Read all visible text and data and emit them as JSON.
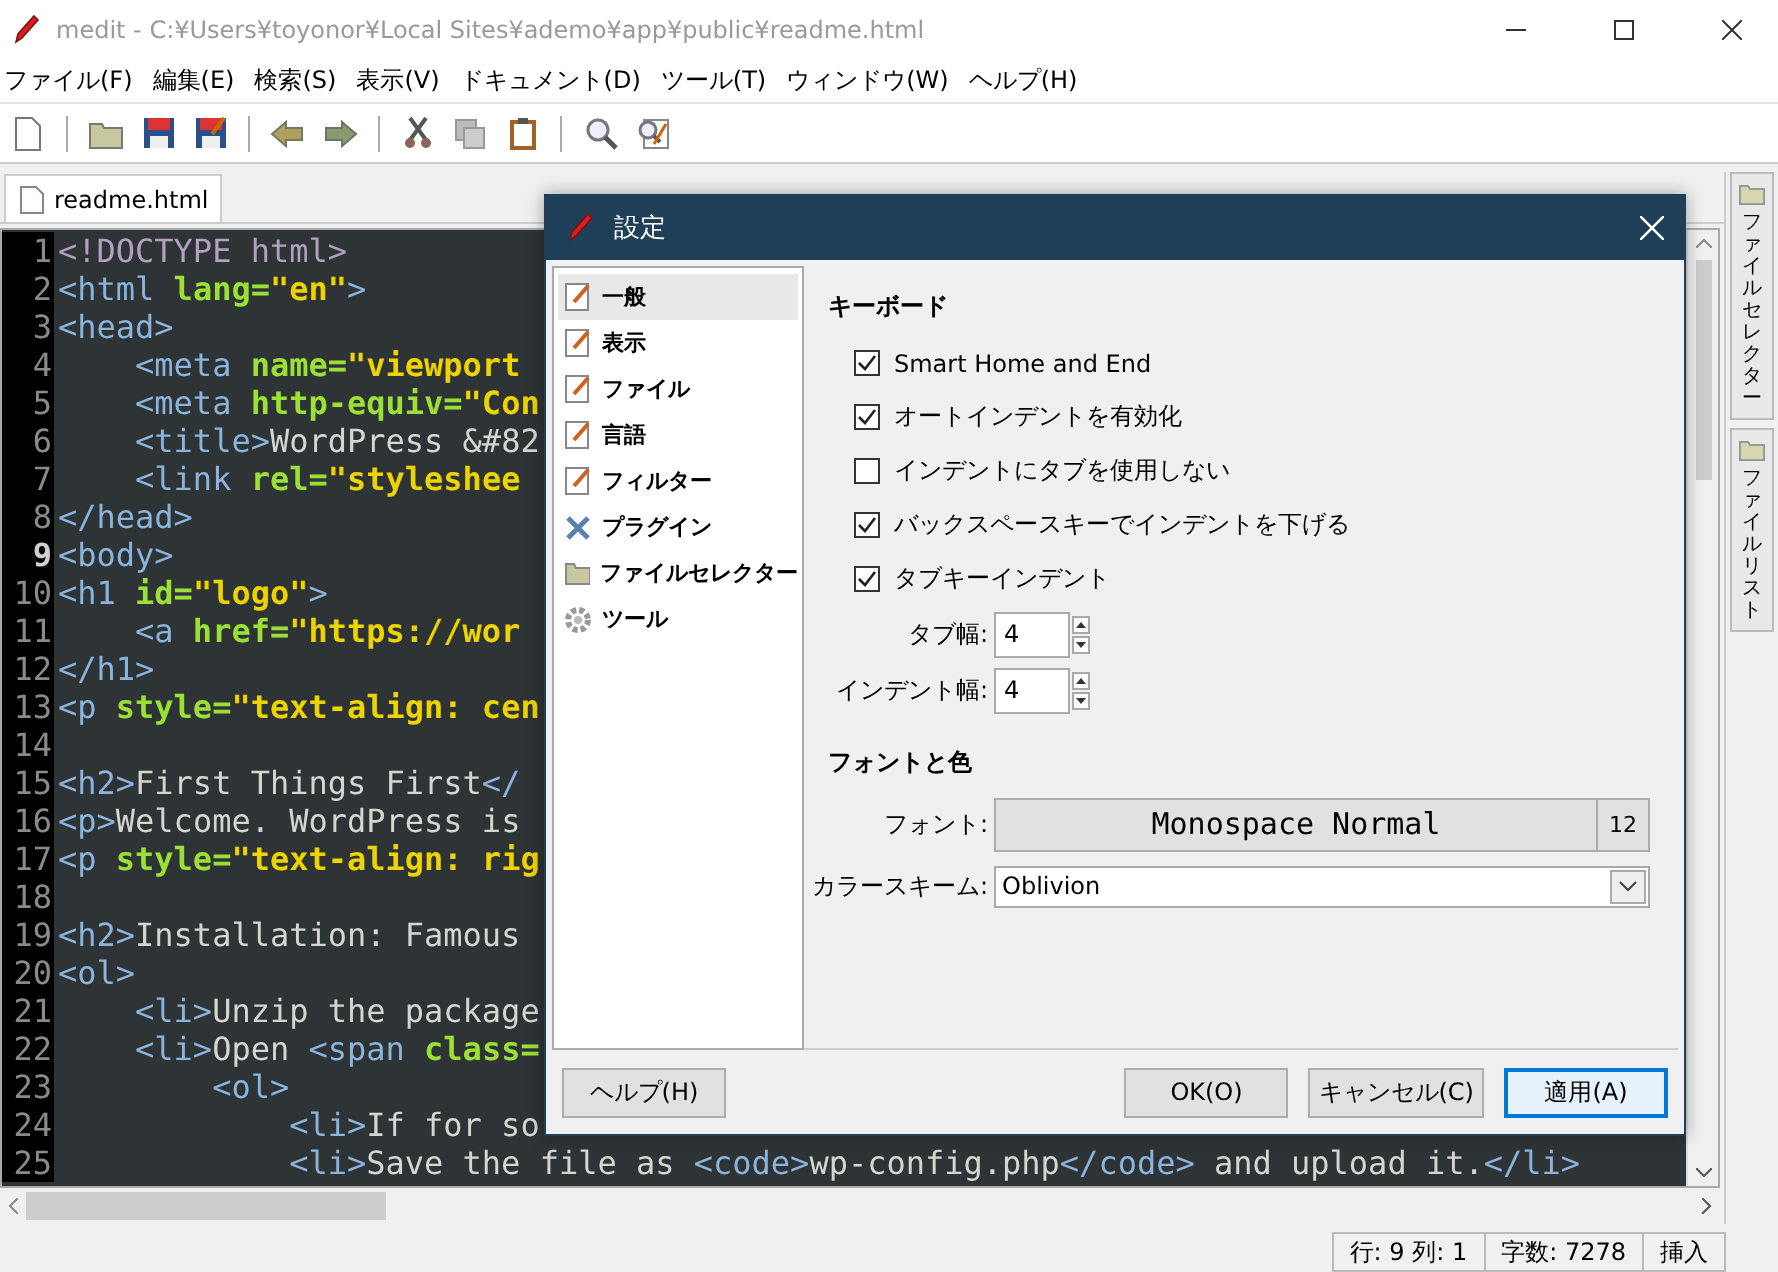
{
  "window": {
    "title": "medit - C:¥Users¥toyonor¥Local Sites¥ademo¥app¥public¥readme.html"
  },
  "menu": [
    "ファイル(F)",
    "編集(E)",
    "検索(S)",
    "表示(V)",
    "ドキュメント(D)",
    "ツール(T)",
    "ウィンドウ(W)",
    "ヘルプ(H)"
  ],
  "tabs": [
    {
      "label": "readme.html",
      "selected": true
    }
  ],
  "editor": {
    "lines": [
      {
        "number": "1",
        "current": false,
        "tokens": [
          {
            "kind": "doctype",
            "text": "<!DOCTYPE html>"
          }
        ]
      },
      {
        "number": "2",
        "current": false,
        "tokens": [
          {
            "kind": "tag",
            "text": "<html"
          },
          {
            "kind": "attr",
            "text": " lang="
          },
          {
            "kind": "string",
            "text": "\"en\""
          },
          {
            "kind": "tag",
            "text": ">"
          }
        ]
      },
      {
        "number": "3",
        "current": false,
        "tokens": [
          {
            "kind": "tag",
            "text": "<head>"
          }
        ]
      },
      {
        "number": "4",
        "current": false,
        "tokens": [
          {
            "kind": "tag",
            "text": "    <meta"
          },
          {
            "kind": "attr",
            "text": " name="
          },
          {
            "kind": "string",
            "text": "\"viewport"
          }
        ]
      },
      {
        "number": "5",
        "current": false,
        "tokens": [
          {
            "kind": "tag",
            "text": "    <meta"
          },
          {
            "kind": "attr",
            "text": " http-equiv="
          },
          {
            "kind": "string",
            "text": "\"Con"
          }
        ]
      },
      {
        "number": "6",
        "current": false,
        "tokens": [
          {
            "kind": "tag",
            "text": "    <title>"
          },
          {
            "kind": "text",
            "text": "WordPress &#82"
          }
        ]
      },
      {
        "number": "7",
        "current": false,
        "tokens": [
          {
            "kind": "tag",
            "text": "    <link"
          },
          {
            "kind": "attr",
            "text": " rel="
          },
          {
            "kind": "string",
            "text": "\"styleshee"
          }
        ]
      },
      {
        "number": "8",
        "current": false,
        "tokens": [
          {
            "kind": "tag",
            "text": "</head>"
          }
        ]
      },
      {
        "number": "9",
        "current": true,
        "tokens": [
          {
            "kind": "tag",
            "text": "<body>"
          }
        ]
      },
      {
        "number": "10",
        "current": false,
        "tokens": [
          {
            "kind": "tag",
            "text": "<h1"
          },
          {
            "kind": "attr",
            "text": " id="
          },
          {
            "kind": "string",
            "text": "\"logo\""
          },
          {
            "kind": "tag",
            "text": ">"
          }
        ]
      },
      {
        "number": "11",
        "current": false,
        "tokens": [
          {
            "kind": "tag",
            "text": "    <a"
          },
          {
            "kind": "attr",
            "text": " href="
          },
          {
            "kind": "string",
            "text": "\"https://wor"
          }
        ]
      },
      {
        "number": "12",
        "current": false,
        "tokens": [
          {
            "kind": "tag",
            "text": "</h1>"
          }
        ]
      },
      {
        "number": "13",
        "current": false,
        "tokens": [
          {
            "kind": "tag",
            "text": "<p"
          },
          {
            "kind": "attr",
            "text": " style="
          },
          {
            "kind": "string",
            "text": "\"text-align: cen"
          }
        ]
      },
      {
        "number": "14",
        "current": false
      },
      {
        "number": "15",
        "current": false,
        "tokens": [
          {
            "kind": "tag",
            "text": "<h2>"
          },
          {
            "kind": "text",
            "text": "First Things First"
          },
          {
            "kind": "tag",
            "text": "</"
          }
        ]
      },
      {
        "number": "16",
        "current": false,
        "tokens": [
          {
            "kind": "tag",
            "text": "<p>"
          },
          {
            "kind": "text",
            "text": "Welcome. WordPress is"
          }
        ]
      },
      {
        "number": "17",
        "current": false,
        "tokens": [
          {
            "kind": "tag",
            "text": "<p"
          },
          {
            "kind": "attr",
            "text": " style="
          },
          {
            "kind": "string",
            "text": "\"text-align: rig"
          }
        ]
      },
      {
        "number": "18",
        "current": false
      },
      {
        "number": "19",
        "current": false,
        "tokens": [
          {
            "kind": "tag",
            "text": "<h2>"
          },
          {
            "kind": "text",
            "text": "Installation: Famous"
          }
        ]
      },
      {
        "number": "20",
        "current": false,
        "tokens": [
          {
            "kind": "tag",
            "text": "<ol>"
          }
        ]
      },
      {
        "number": "21",
        "current": false,
        "tokens": [
          {
            "kind": "tag",
            "text": "    <li>"
          },
          {
            "kind": "text",
            "text": "Unzip the package"
          }
        ]
      },
      {
        "number": "22",
        "current": false,
        "tokens": [
          {
            "kind": "tag",
            "text": "    <li>"
          },
          {
            "kind": "text",
            "text": "Open "
          },
          {
            "kind": "tag",
            "text": "<span"
          },
          {
            "kind": "attr",
            "text": " class="
          }
        ]
      },
      {
        "number": "23",
        "current": false,
        "tokens": [
          {
            "kind": "tag",
            "text": "        <ol>"
          }
        ]
      },
      {
        "number": "24",
        "current": false,
        "tokens": [
          {
            "kind": "tag",
            "text": "            <li>"
          },
          {
            "kind": "text",
            "text": "If for so"
          }
        ]
      },
      {
        "number": "25",
        "current": false,
        "tokens": [
          {
            "kind": "tag",
            "text": "            <li>"
          },
          {
            "kind": "text",
            "text": "Save the file as "
          },
          {
            "kind": "tag",
            "text": "<code>"
          },
          {
            "kind": "text",
            "text": "wp-config.php"
          },
          {
            "kind": "tag",
            "text": "</code>"
          },
          {
            "kind": "text",
            "text": " and upload it."
          },
          {
            "kind": "tag",
            "text": "</li>"
          }
        ]
      }
    ]
  },
  "side_tabs": [
    {
      "label": "ファイルセレクター"
    },
    {
      "label": "ファイルリスト"
    }
  ],
  "dialog": {
    "title": "設定",
    "categories": [
      {
        "label": "一般",
        "kind": "doc",
        "selected": true
      },
      {
        "label": "表示",
        "kind": "doc",
        "selected": false
      },
      {
        "label": "ファイル",
        "kind": "doc",
        "selected": false
      },
      {
        "label": "言語",
        "kind": "doc",
        "selected": false
      },
      {
        "label": "フィルター",
        "kind": "doc",
        "selected": false
      },
      {
        "label": "プラグイン",
        "kind": "tools",
        "selected": false
      },
      {
        "label": "ファイルセレクター",
        "kind": "folder",
        "selected": false
      },
      {
        "label": "ツール",
        "kind": "gear",
        "selected": false
      }
    ],
    "keyboard": {
      "heading": "キーボード",
      "options": [
        {
          "label": "Smart Home and End",
          "checked": true
        },
        {
          "label": "オートインデントを有効化",
          "checked": true
        },
        {
          "label": "インデントにタブを使用しない",
          "checked": false
        },
        {
          "label": "バックスペースキーでインデントを下げる",
          "checked": true
        },
        {
          "label": "タブキーインデント",
          "checked": true
        }
      ],
      "spinners": [
        {
          "label": "タブ幅:",
          "value": "4"
        },
        {
          "label": "インデント幅:",
          "value": "4"
        }
      ]
    },
    "fonts": {
      "heading": "フォントと色",
      "font_label": "フォント:",
      "font_name": "Monospace Normal",
      "font_size": "12",
      "scheme_label": "カラースキーム:",
      "scheme_value": "Oblivion"
    },
    "buttons": [
      {
        "label": "ヘルプ(H)",
        "kind": "help",
        "default": false
      },
      {
        "label": "OK(O)",
        "kind": "ok",
        "default": false
      },
      {
        "label": "キャンセル(C)",
        "kind": "cancel",
        "default": false
      },
      {
        "label": "適用(A)",
        "kind": "apply",
        "default": true
      }
    ]
  },
  "status": [
    "行: 9 列: 1",
    "字数: 7278",
    "挿入"
  ]
}
